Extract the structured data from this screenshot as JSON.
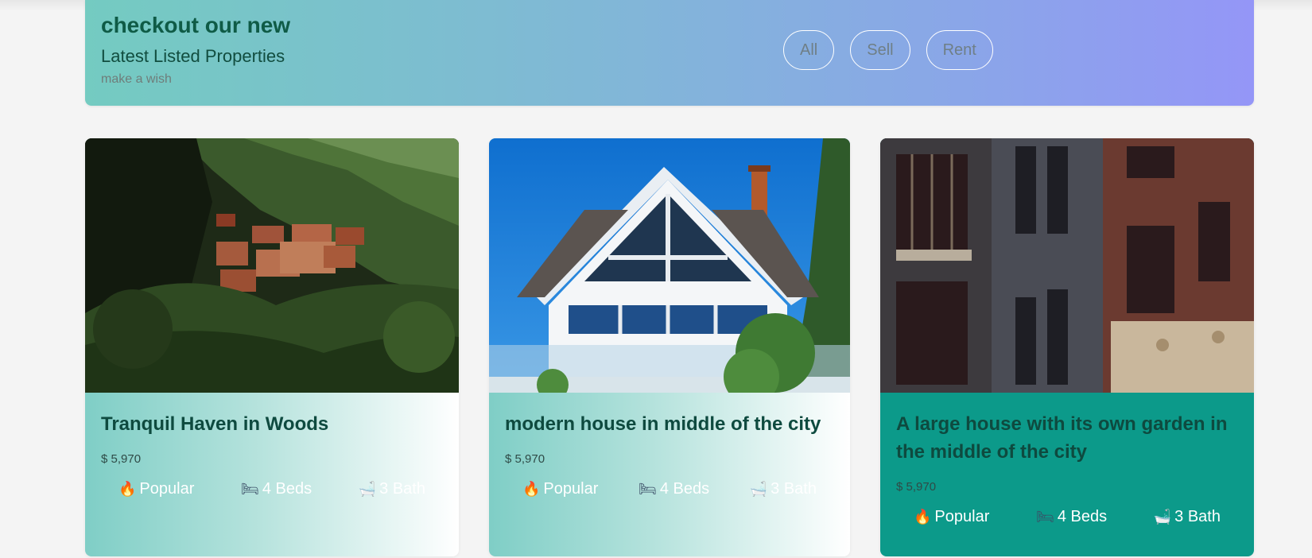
{
  "hero": {
    "title": "checkout our new",
    "subtitle": "Latest Listed Properties",
    "tagline": "make a wish",
    "filters": [
      "All",
      "Sell",
      "Rent"
    ]
  },
  "listings": [
    {
      "title": "Tranquil Haven in Woods",
      "price": "$ 5,970",
      "features": [
        {
          "icon": "fire-icon",
          "glyph": "🔥",
          "label": "Popular"
        },
        {
          "icon": "bed-icon",
          "glyph": "🛏",
          "label": "4 Beds"
        },
        {
          "icon": "bathtub-icon",
          "glyph": "🛁",
          "label": "3 Bath"
        }
      ]
    },
    {
      "title": "modern house in middle of the city",
      "price": "$ 5,970",
      "features": [
        {
          "icon": "fire-icon",
          "glyph": "🔥",
          "label": "Popular"
        },
        {
          "icon": "bed-icon",
          "glyph": "🛏",
          "label": "4 Beds"
        },
        {
          "icon": "bathtub-icon",
          "glyph": "🛁",
          "label": "3 Bath"
        }
      ]
    },
    {
      "title": "A large house with its own garden in the middle of the city",
      "price": "$ 5,970",
      "features": [
        {
          "icon": "fire-icon",
          "glyph": "🔥",
          "label": "Popular"
        },
        {
          "icon": "bed-icon",
          "glyph": "🛏",
          "label": "4 Beds"
        },
        {
          "icon": "bathtub-icon",
          "glyph": "🛁",
          "label": "3 Bath"
        }
      ]
    }
  ],
  "colors": {
    "hero_gradient_start": "#74cbc1",
    "hero_gradient_end": "#9496f7",
    "title_green": "#0f5b46",
    "card_teal": "#0c9a8a"
  }
}
